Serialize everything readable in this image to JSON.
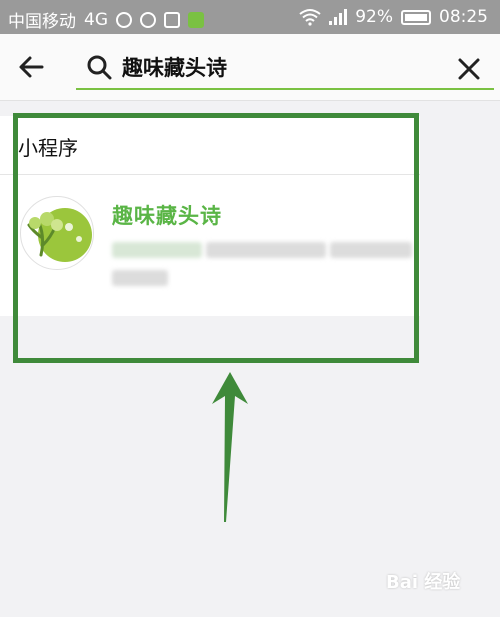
{
  "status_bar": {
    "carrier": "中国移动",
    "network": "4G",
    "battery_percent": "92%",
    "time": "08:25",
    "icons": [
      "hd-call-icon",
      "sync-icon",
      "image-icon",
      "app-notification-icon",
      "wifi-icon",
      "signal-icon",
      "battery-icon"
    ]
  },
  "search": {
    "query": "趣味藏头诗",
    "back_icon": "arrow-left-icon",
    "search_icon": "magnifier-icon",
    "clear_icon": "close-icon",
    "accent_color": "#7ac142"
  },
  "results": {
    "section_title": "小程序",
    "items": [
      {
        "name": "趣味藏头诗",
        "avatar": "tree-logo-icon",
        "name_color": "#5ab546"
      }
    ]
  },
  "annotation": {
    "frame_color": "#3f8a3a",
    "arrow_color": "#3f8a3a"
  },
  "watermark": {
    "text": "Bai 经验"
  }
}
